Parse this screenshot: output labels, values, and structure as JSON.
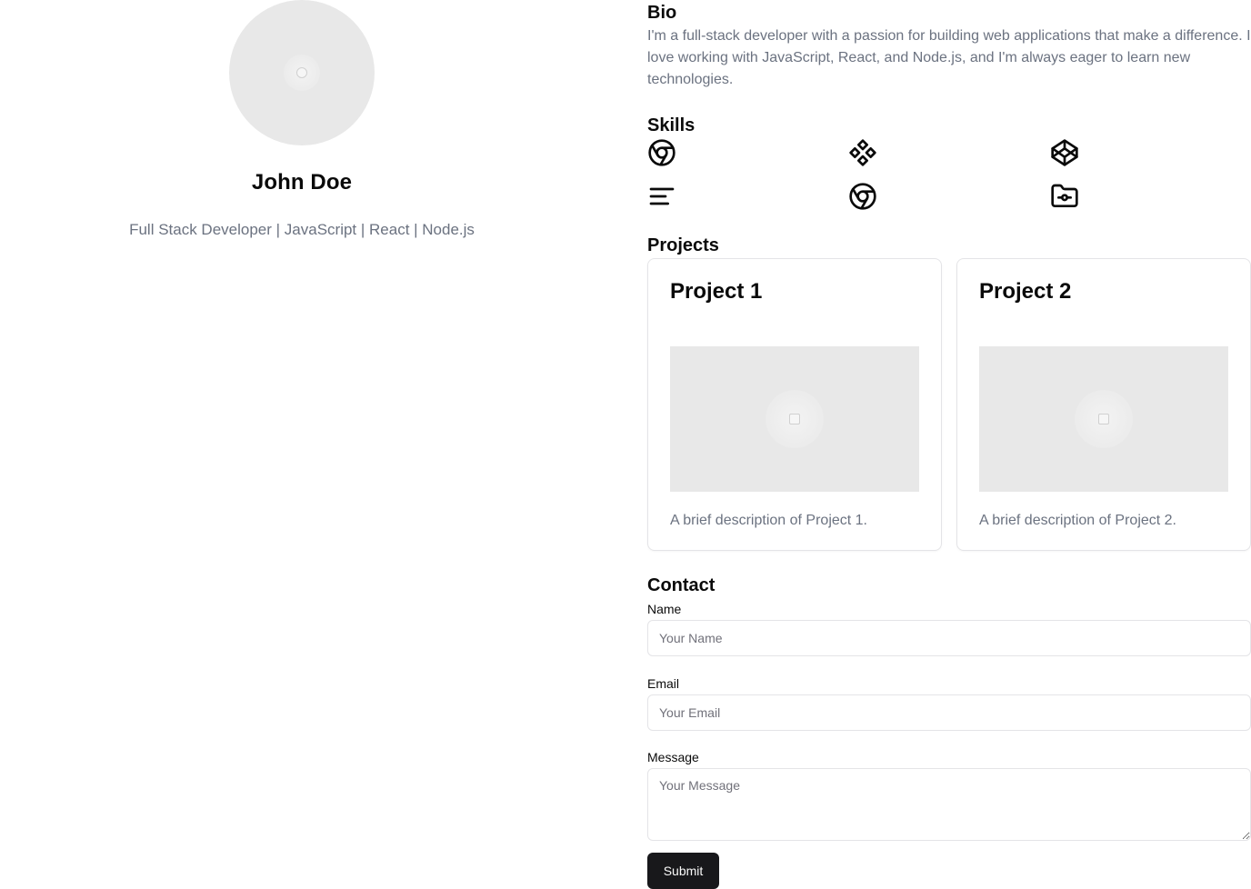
{
  "profile": {
    "name": "John Doe",
    "tagline": "Full Stack Developer | JavaScript | React | Node.js"
  },
  "bio": {
    "title": "Bio",
    "text": "I'm a full-stack developer with a passion for building web applications that make a difference. I love working with JavaScript, React, and Node.js, and I'm always eager to learn new technologies."
  },
  "skills": {
    "title": "Skills",
    "icons": [
      "chrome-icon",
      "component-icon",
      "codepen-icon",
      "align-left-icon",
      "chrome-icon",
      "folder-git-icon"
    ]
  },
  "projects": {
    "title": "Projects",
    "items": [
      {
        "title": "Project 1",
        "description": "A brief description of Project 1."
      },
      {
        "title": "Project 2",
        "description": "A brief description of Project 2."
      }
    ]
  },
  "contact": {
    "title": "Contact",
    "name_label": "Name",
    "name_placeholder": "Your Name",
    "email_label": "Email",
    "email_placeholder": "Your Email",
    "message_label": "Message",
    "message_placeholder": "Your Message",
    "submit_label": "Submit"
  },
  "colors": {
    "text_primary": "#0a0a0a",
    "text_muted": "#6b7280",
    "button_bg": "#18181b",
    "placeholder_bg": "#e8e8e8",
    "border": "#e4e4e7"
  }
}
